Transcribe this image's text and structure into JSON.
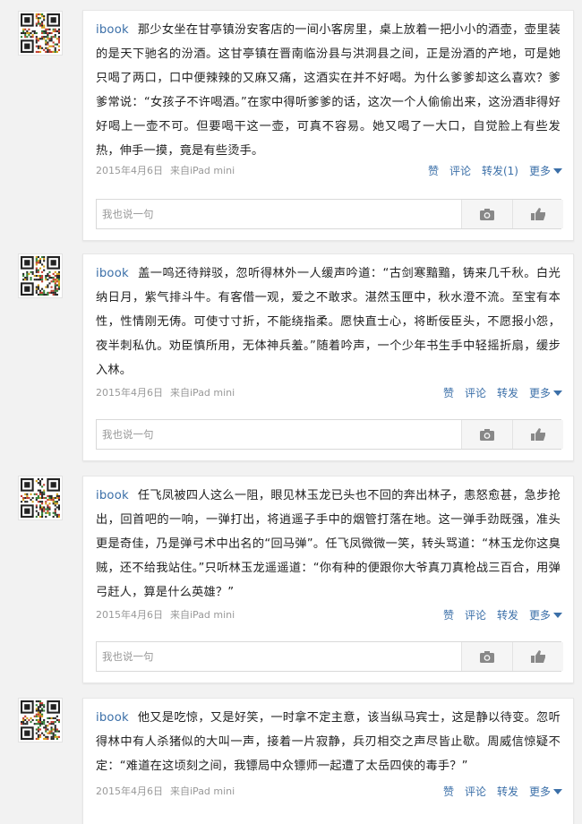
{
  "comment_placeholder": "我也说一句",
  "posts": [
    {
      "username": "ibook",
      "text": "那少女坐在甘亭镇汾安客店的一间小客房里，桌上放着一把小小的酒壶，壶里装的是天下驰名的汾酒。这甘亭镇在晋南临汾县与洪洞县之间，正是汾酒的产地，可是她只喝了两口，口中便辣辣的又麻又痛，这酒实在并不好喝。为什么爹爹却这么喜欢？爹爹常说：“女孩子不许喝酒。”在家中得听爹爹的话，这次一个人偷偷出来，这汾酒非得好好喝上一壶不可。但要喝干这一壶，可真不容易。她又喝了一大口，自觉脸上有些发热，伸手一摸，竟是有些烫手。",
      "date": "2015年4月6日",
      "source": "来自iPad mini",
      "like": "赞",
      "comment": "评论",
      "repost": "转发(1)",
      "more": "更多"
    },
    {
      "username": "ibook",
      "text": "盖一鸣还待辩驳，忽听得林外一人缓声吟道：“古剑寒黯黯，铸来几千秋。白光纳日月，紫气排斗牛。有客借一观，爱之不敢求。湛然玉匣中，秋水澄不流。至宝有本性，性情刚无俦。可使寸寸折，不能绕指柔。愿快直士心，将断佞臣头，不愿报小怨，夜半刺私仇。劝臣慎所用，无体神兵羞。”随着吟声，一个少年书生手中轻摇折扇，缓步入林。",
      "date": "2015年4月6日",
      "source": "来自iPad mini",
      "like": "赞",
      "comment": "评论",
      "repost": "转发",
      "more": "更多"
    },
    {
      "username": "ibook",
      "text": "任飞凤被四人这么一阻，眼见林玉龙已头也不回的奔出林子，恚怒愈甚，急步抢出，回首吧的一响，一弹打出，将逍遥子手中的烟管打落在地。这一弹手劲既强，准头更是奇佳，乃是弹弓术中出名的“回马弹”。任飞凤微微一笑，转头骂道：“林玉龙你这臭贼，还不给我站住。”只听林玉龙遥遥道：“你有种的便跟你大爷真刀真枪战三百合，用弹弓赶人，算是什么英雄？”",
      "date": "2015年4月6日",
      "source": "来自iPad mini",
      "like": "赞",
      "comment": "评论",
      "repost": "转发",
      "more": "更多"
    },
    {
      "username": "ibook",
      "text": "他又是吃惊，又是好笑，一时拿不定主意，该当纵马宾士，这是静以待变。忽听得林中有人杀猪似的大叫一声，接着一片寂静，兵刃相交之声尽皆止歇。周威信惊疑不定：“难道在这顷刻之间，我镖局中众镖师一起遭了太岳四侠的毒手？”",
      "date": "2015年4月6日",
      "source": "来自iPad mini",
      "like": "赞",
      "comment": "评论",
      "repost": "转发",
      "more": "更多"
    }
  ]
}
